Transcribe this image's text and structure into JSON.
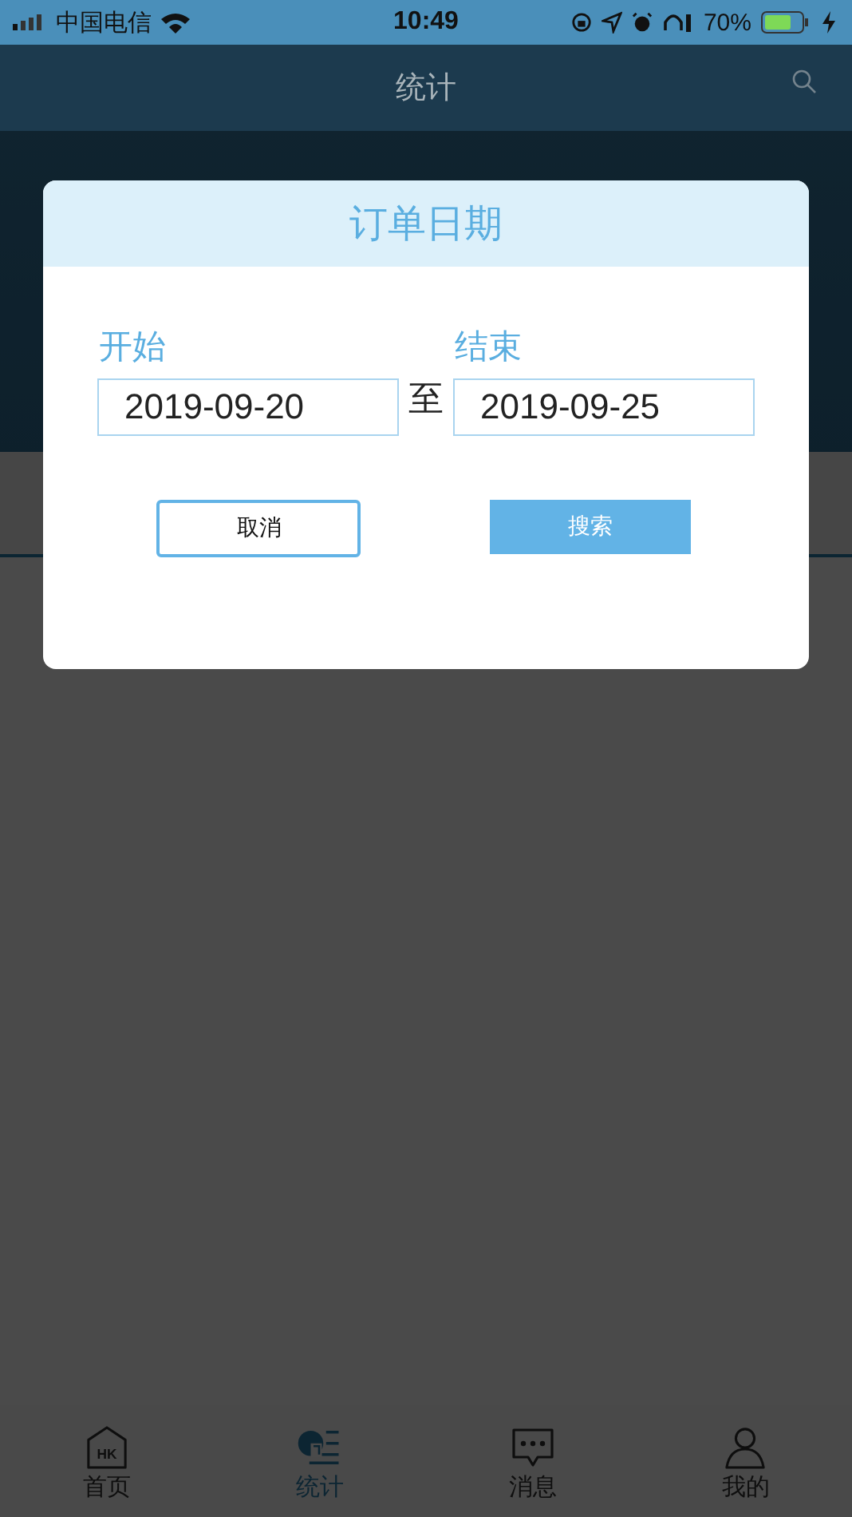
{
  "status_bar": {
    "carrier": "中国电信",
    "time": "10:49",
    "battery_text": "70%"
  },
  "header": {
    "title": "统计"
  },
  "dialog": {
    "title": "订单日期",
    "start": {
      "label": "开始",
      "value": "2019-09-20"
    },
    "separator": "至",
    "end": {
      "label": "结束",
      "value": "2019-09-25"
    },
    "buttons": [
      {
        "label": "取消",
        "kind": "outline"
      },
      {
        "label": "搜索",
        "kind": "primary"
      }
    ]
  },
  "tab_bar": [
    {
      "label": "首页",
      "kind": "home",
      "icon_text": "HK",
      "selected": false
    },
    {
      "label": "统计",
      "kind": "chart",
      "selected": true
    },
    {
      "label": "消息",
      "kind": "message",
      "selected": false
    },
    {
      "label": "我的",
      "kind": "person",
      "selected": false
    }
  ]
}
